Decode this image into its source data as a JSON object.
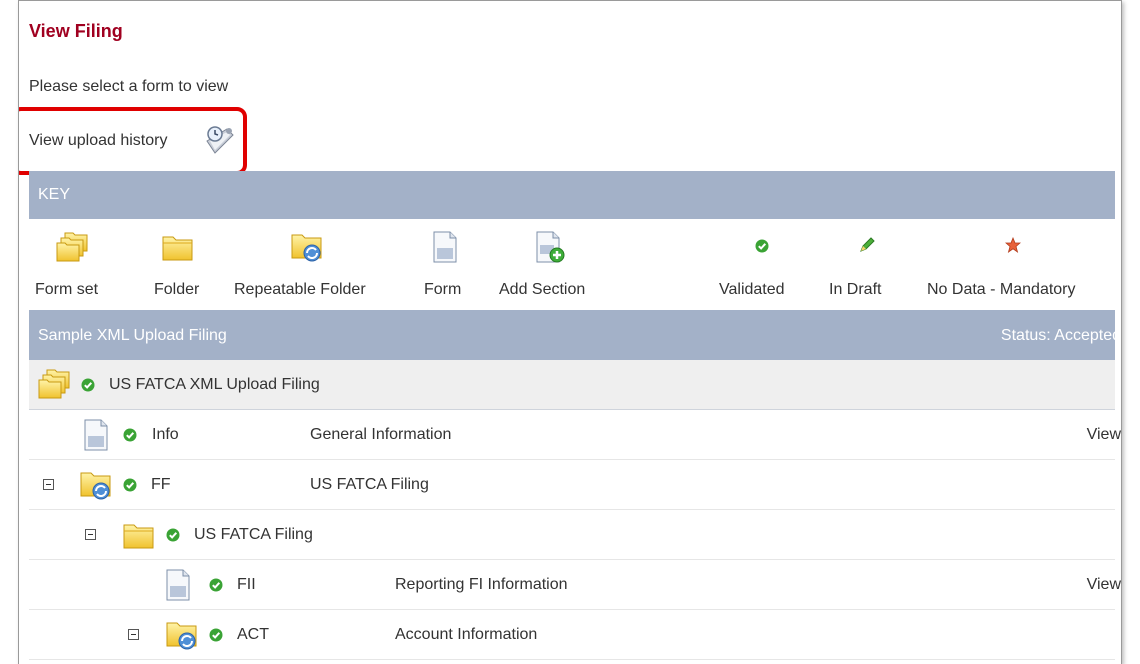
{
  "page": {
    "title": "View Filing",
    "instruction": "Please select a form to view",
    "upload_history_label": "View upload history"
  },
  "key": {
    "header": "KEY",
    "items": [
      {
        "label": "Form set",
        "icon": "form-set-icon"
      },
      {
        "label": "Folder",
        "icon": "folder-icon"
      },
      {
        "label": "Repeatable Folder",
        "icon": "repeatable-folder-icon"
      },
      {
        "label": "Form",
        "icon": "form-icon"
      },
      {
        "label": "Add Section",
        "icon": "add-section-icon"
      },
      {
        "label": "Validated",
        "icon": "validated-icon"
      },
      {
        "label": "In Draft",
        "icon": "in-draft-icon"
      },
      {
        "label": "No Data - Mandatory",
        "icon": "no-data-mandatory-icon"
      }
    ]
  },
  "filing": {
    "name": "Sample XML Upload Filing",
    "status": "Status: Accepted",
    "rows": [
      {
        "code": "US FATCA XML Upload Filing",
        "description": "",
        "action": ""
      },
      {
        "code": "Info",
        "description": "General Information",
        "action": "View"
      },
      {
        "code": "FF",
        "description": "US FATCA Filing",
        "action": ""
      },
      {
        "code": "US FATCA Filing",
        "description": "",
        "action": ""
      },
      {
        "code": "FII",
        "description": "Reporting FI Information",
        "action": "View"
      },
      {
        "code": "ACT",
        "description": "Account Information",
        "action": ""
      }
    ]
  },
  "colors": {
    "title": "#a00020",
    "header_bar": "#a3b1c8",
    "highlight": "#e00000",
    "validated": "#3aa335",
    "folder": "#f2cb3a"
  }
}
